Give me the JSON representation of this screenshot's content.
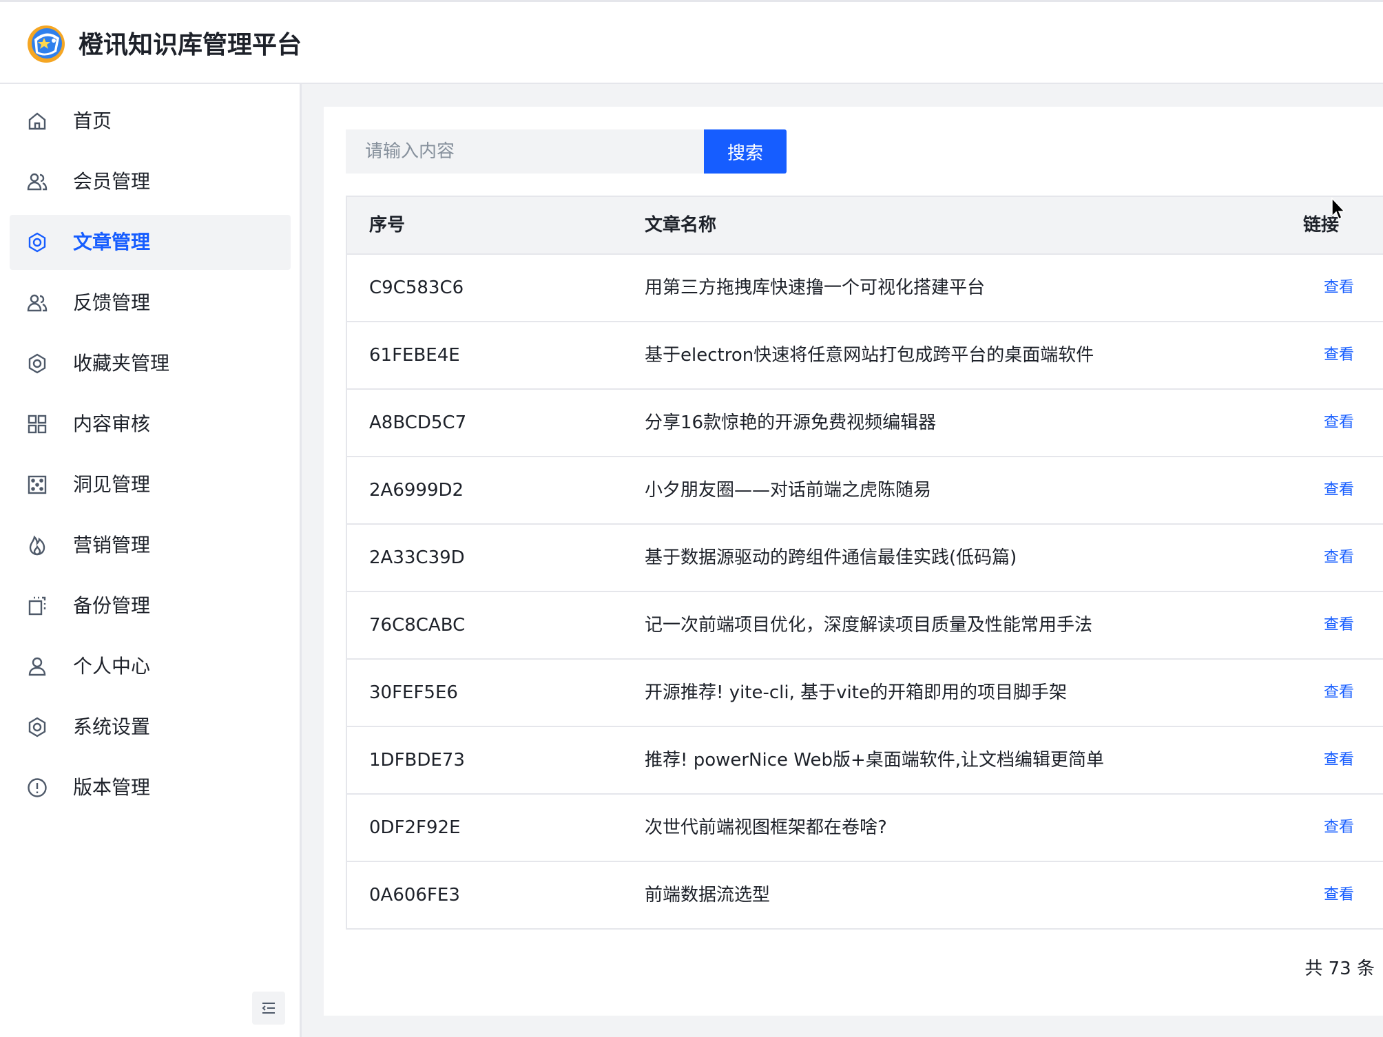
{
  "app": {
    "title": "橙讯知识库管理平台"
  },
  "sidebar": {
    "items": [
      {
        "label": "首页",
        "icon": "home-icon"
      },
      {
        "label": "会员管理",
        "icon": "users-icon"
      },
      {
        "label": "文章管理",
        "icon": "gear-icon",
        "active": true
      },
      {
        "label": "反馈管理",
        "icon": "users-icon"
      },
      {
        "label": "收藏夹管理",
        "icon": "gear-icon"
      },
      {
        "label": "内容审核",
        "icon": "grid-icon"
      },
      {
        "label": "洞见管理",
        "icon": "dice-icon"
      },
      {
        "label": "营销管理",
        "icon": "fire-icon"
      },
      {
        "label": "备份管理",
        "icon": "copy-icon"
      },
      {
        "label": "个人中心",
        "icon": "user-icon"
      },
      {
        "label": "系统设置",
        "icon": "gear-icon"
      },
      {
        "label": "版本管理",
        "icon": "exclamation-circle-icon"
      }
    ],
    "collapse_icon": "menu-fold-icon"
  },
  "search": {
    "placeholder": "请输入内容",
    "value": "",
    "button_label": "搜索"
  },
  "table": {
    "columns": [
      "序号",
      "文章名称",
      "链接"
    ],
    "rows": [
      {
        "id": "C9C583C6",
        "name": "用第三方拖拽库快速撸一个可视化搭建平台",
        "link": "查看"
      },
      {
        "id": "61FEBE4E",
        "name": "基于electron快速将任意网站打包成跨平台的桌面端软件",
        "link": "查看"
      },
      {
        "id": "A8BCD5C7",
        "name": "分享16款惊艳的开源免费视频编辑器",
        "link": "查看"
      },
      {
        "id": "2A6999D2",
        "name": "小夕朋友圈——对话前端之虎陈随易",
        "link": "查看"
      },
      {
        "id": "2A33C39D",
        "name": "基于数据源驱动的跨组件通信最佳实践(低码篇)",
        "link": "查看"
      },
      {
        "id": "76C8CABC",
        "name": "记一次前端项目优化，深度解读项目质量及性能常用手法",
        "link": "查看"
      },
      {
        "id": "30FEF5E6",
        "name": "开源推荐! yite-cli, 基于vite的开箱即用的项目脚手架",
        "link": "查看"
      },
      {
        "id": "1DFBDE73",
        "name": "推荐! powerNice Web版+桌面端软件,让文档编辑更简单",
        "link": "查看"
      },
      {
        "id": "0DF2F92E",
        "name": "次世代前端视图框架都在卷啥?",
        "link": "查看"
      },
      {
        "id": "0A606FE3",
        "name": "前端数据流选型",
        "link": "查看"
      }
    ]
  },
  "pagination": {
    "total_text": "共 73 条"
  },
  "colors": {
    "accent": "#165dff",
    "background": "#f2f3f5",
    "text": "#1d2129",
    "border": "#e5e6eb"
  }
}
